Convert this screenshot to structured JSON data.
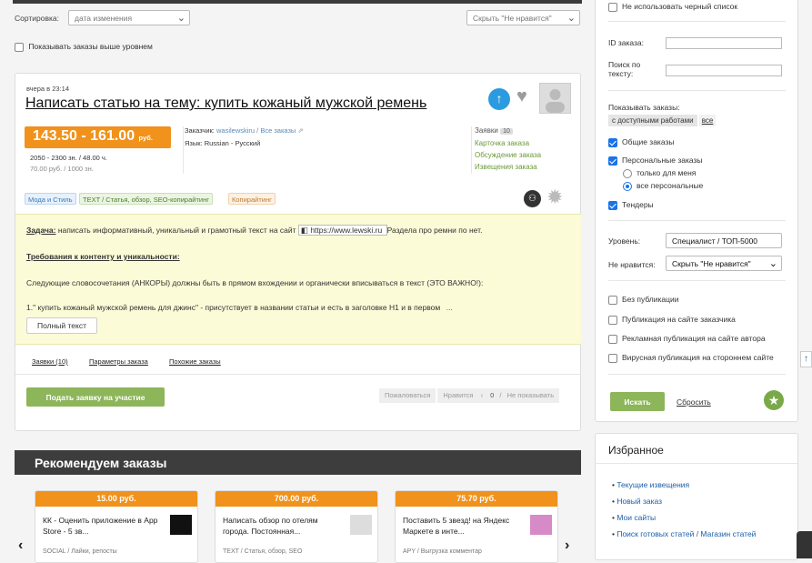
{
  "sort": {
    "label": "Сортировка:",
    "value": "дата изменения",
    "hide_value": "Скрыть \"Не нравится\""
  },
  "show_above": "Показывать заказы выше уровнем",
  "order": {
    "date": "вчера в 23:14",
    "title": "Написать статью на тему: купить кожаный мужской ремень",
    "price": "143.50 - 161.00",
    "price_unit": "руб.",
    "stats1": "2050 - 2300 зн. / 48.00 ч.",
    "stats2": "70.00 руб. / 1000 зн.",
    "customer_label": "Заказчик:",
    "customer_name": "wasilewskiru",
    "all_orders": "/ Все заказы",
    "lang": "Язык: Russian - Русский",
    "bids_label": "Заявки",
    "bids_count": "10",
    "links": [
      "Карточка заказа",
      "Обсуждение заказа",
      "Извещения заказа"
    ],
    "tags": [
      "Мода и Стиль",
      "TEXT / Статья, обзор, SEO-копирайтинг",
      "Копирайтинг"
    ],
    "task_label": "Задача:",
    "task_text": "написать информативный, уникальный и грамотный текст на сайт",
    "task_url": "https://www.lewski.ru",
    "task_tail": "Раздела про ремни по нет.",
    "req": "Требования к контенту и уникальности:",
    "p1": "Следующие словосочетания (АНКОРЫ) должны быть в прямом вхождении и органически вписываться в текст (ЭТО ВАЖНО!):",
    "p2": "1.\" купить кожаный мужской ремень для джинс\" - присутствует в названии статьи и есть в заголовке H1 и в первом",
    "more": "...",
    "full_text": "Полный текст",
    "subtabs": [
      "Заявки (10)",
      "Параметры заказа",
      "Похожие заказы"
    ],
    "apply": "Подать заявку на участие",
    "actions": [
      "Пожаловаться",
      "Нравится",
      "0",
      "Не показывать"
    ]
  },
  "recommend": {
    "title": "Рекомендуем заказы",
    "cards": [
      {
        "price": "15.00 руб.",
        "text": "КК - Оценить приложение в App Store - 5 зв...",
        "footer": "SOCIAL / Лайки, репосты"
      },
      {
        "price": "700.00 руб.",
        "text": "Написать обзор по отелям города. Постоянная...",
        "footer": "TEXT / Статья, обзор, SEO"
      },
      {
        "price": "75.70 руб.",
        "text": "Поставить 5 звезд! на Яндекс Маркете в инте...",
        "footer": "APY / Выгрузка комментар"
      }
    ]
  },
  "filters": {
    "no_blacklist": "Не использовать черный список",
    "id_label": "ID заказа:",
    "search_label": "Поиск по тексту:",
    "show_label": "Показывать заказы:",
    "chip_available": "с доступными работами",
    "chip_all": "все",
    "general": "Общие заказы",
    "personal": "Персональные заказы",
    "only_me": "только для меня",
    "all_personal": "все персональные",
    "tenders": "Тендеры",
    "level_label": "Уровень:",
    "level_value": "Специалист / ТОП-5000",
    "dislike_label": "Не нравится:",
    "dislike_value": "Скрыть \"Не нравится\"",
    "pub": [
      "Без публикации",
      "Публикация на сайте заказчика",
      "Рекламная публикация на сайте автора",
      "Вирусная публикация на стороннем сайте"
    ],
    "search_btn": "Искать",
    "reset": "Сбросить"
  },
  "favorites": {
    "title": "Избранное",
    "links": [
      "Текущие извещения",
      "Новый заказ",
      "Мои сайты",
      "Поиск готовых статей / Магазин статей"
    ]
  }
}
